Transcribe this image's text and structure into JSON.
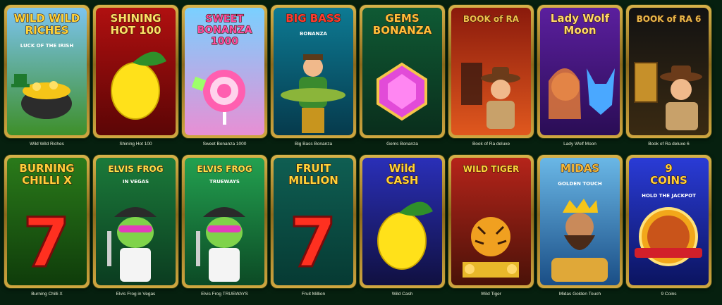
{
  "games": [
    {
      "title": "Wild Wild Riches",
      "logo_lines": [
        "WILD WILD",
        "RICHES"
      ],
      "sub": "LUCK OF THE IRISH",
      "bg1": "#7cc4ef",
      "bg2": "#3e8f2a",
      "logo_color": "#ffd43b",
      "icon": "pot-of-gold-icon"
    },
    {
      "title": "Shining Hot 100",
      "logo_lines": [
        "SHINING",
        "HOT 100"
      ],
      "sub": "",
      "bg1": "#b01010",
      "bg2": "#5b0505",
      "logo_color": "#ffe066",
      "icon": "lemon-icon"
    },
    {
      "title": "Sweet Bonanza 1000",
      "logo_lines": [
        "SWEET",
        "BONANZA",
        "1000"
      ],
      "sub": "",
      "bg1": "#7ad0ff",
      "bg2": "#e88fd4",
      "logo_color": "#ff4fa3",
      "icon": "lollipop-icon"
    },
    {
      "title": "Big Bass Bonanza",
      "logo_lines": [
        "BIG BASS"
      ],
      "sub": "BONANZA",
      "bg1": "#0d7a93",
      "bg2": "#063a4c",
      "logo_color": "#ff3b2f",
      "icon": "fisherman-icon"
    },
    {
      "title": "Gems Bonanza",
      "logo_lines": [
        "GEMS",
        "BONANZA"
      ],
      "sub": "",
      "bg1": "#0f5a34",
      "bg2": "#0a2e1c",
      "logo_color": "#ffbf3a",
      "icon": "gem-icon"
    },
    {
      "title": "Book of Ra deluxe",
      "logo_lines": [
        "BOOK of RA"
      ],
      "sub": "",
      "bg1": "#8a1a0c",
      "bg2": "#e0581e",
      "logo_color": "#f2c04a",
      "icon": "explorer-icon"
    },
    {
      "title": "Lady Wolf Moon",
      "logo_lines": [
        "Lady Wolf",
        "Moon"
      ],
      "sub": "",
      "bg1": "#5b1f9e",
      "bg2": "#2a0d55",
      "logo_color": "#ffd86b",
      "icon": "wolf-icon"
    },
    {
      "title": "Book of Ra deluxe 6",
      "logo_lines": [
        "BOOK of RA 6"
      ],
      "sub": "",
      "bg1": "#121212",
      "bg2": "#3a2a12",
      "logo_color": "#e8b94a",
      "icon": "book-icon"
    },
    {
      "title": "Burning Chilli X",
      "logo_lines": [
        "BURNING",
        "CHILLI X"
      ],
      "sub": "",
      "bg1": "#2a7a1a",
      "bg2": "#0f3c0a",
      "logo_color": "#ffcf3a",
      "icon": "seven-icon"
    },
    {
      "title": "Elvis Frog in Vegas",
      "logo_lines": [
        "ELVIS FROG"
      ],
      "sub": "IN VEGAS",
      "bg1": "#1b7a3a",
      "bg2": "#0b3c20",
      "logo_color": "#ffe24a",
      "icon": "frog-icon"
    },
    {
      "title": "Elvis Frog TRUEWAYS",
      "logo_lines": [
        "ELVIS FROG"
      ],
      "sub": "TRUEWAYS",
      "bg1": "#23a150",
      "bg2": "#0c4a25",
      "logo_color": "#ffe24a",
      "icon": "frog-icon"
    },
    {
      "title": "Fruit Million",
      "logo_lines": [
        "FRUIT",
        "MILLION"
      ],
      "sub": "",
      "bg1": "#0f5e52",
      "bg2": "#063a33",
      "logo_color": "#ffd33a",
      "icon": "seven-icon"
    },
    {
      "title": "Wild Cash",
      "logo_lines": [
        "Wild",
        "CASH"
      ],
      "sub": "",
      "bg1": "#2a2fb8",
      "bg2": "#101040",
      "logo_color": "#ffd23a",
      "icon": "lemon-icon"
    },
    {
      "title": "Wild Tiger",
      "logo_lines": [
        "WILD TIGER"
      ],
      "sub": "",
      "bg1": "#b5241a",
      "bg2": "#4a1208",
      "logo_color": "#ffd23a",
      "icon": "tiger-icon"
    },
    {
      "title": "Midas Golden Touch",
      "logo_lines": [
        "MIDAS"
      ],
      "sub": "GOLDEN TOUCH",
      "bg1": "#6ab7e6",
      "bg2": "#1a4e86",
      "logo_color": "#f2b83a",
      "icon": "king-icon"
    },
    {
      "title": "9 Coins",
      "logo_lines": [
        "9",
        "COINS"
      ],
      "sub": "HOLD THE JACKPOT",
      "bg1": "#2a3bd6",
      "bg2": "#0b1460",
      "logo_color": "#ffcf3a",
      "icon": "coin-icon"
    }
  ]
}
